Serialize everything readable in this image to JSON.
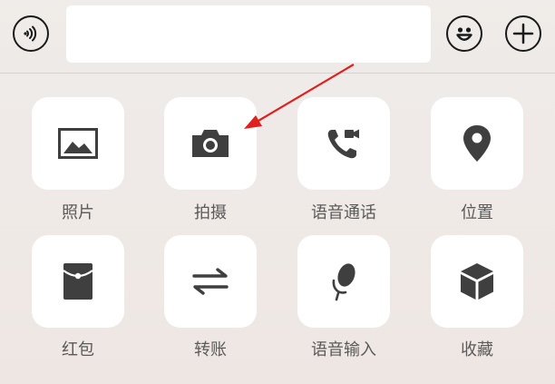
{
  "input_bar": {
    "voice_icon": "voice-input-icon",
    "text_value": "",
    "emoji_icon": "smiley-face-icon",
    "plus_icon": "plus-icon"
  },
  "panel": {
    "items": [
      {
        "label": "照片",
        "icon": "photo-icon"
      },
      {
        "label": "拍摄",
        "icon": "camera-icon"
      },
      {
        "label": "语音通话",
        "icon": "video-call-icon"
      },
      {
        "label": "位置",
        "icon": "location-pin-icon"
      },
      {
        "label": "红包",
        "icon": "red-packet-icon"
      },
      {
        "label": "转账",
        "icon": "transfer-icon"
      },
      {
        "label": "语音输入",
        "icon": "microphone-icon"
      },
      {
        "label": "收藏",
        "icon": "favorites-box-icon"
      }
    ]
  },
  "annotation": {
    "arrow_color": "#e02020",
    "target": "拍摄"
  },
  "colors": {
    "icon": "#3f3f3f",
    "label": "#5a5a5a",
    "tile": "#ffffff",
    "background": "#efebe9"
  }
}
